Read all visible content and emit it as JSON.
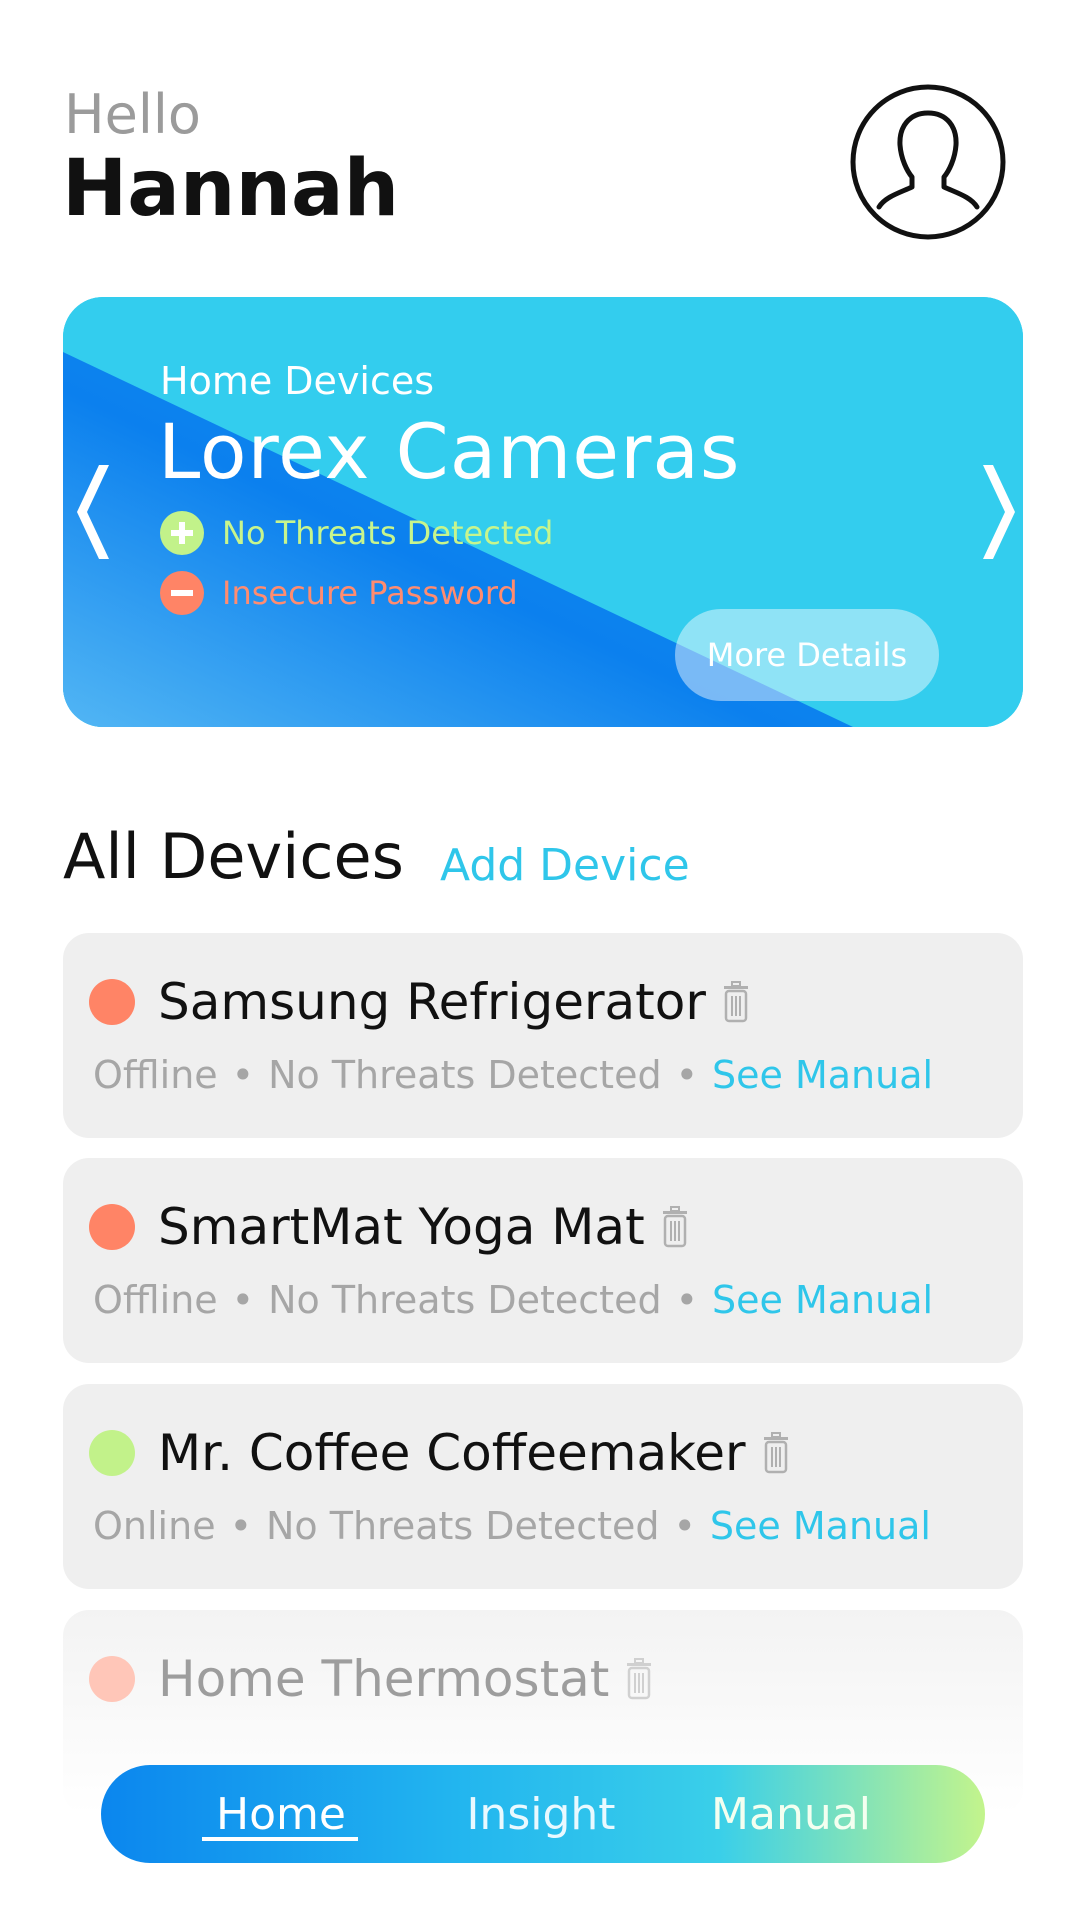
{
  "header": {
    "greeting": "Hello",
    "user_name": "Hannah",
    "avatar_icon": "user-avatar-icon"
  },
  "hero": {
    "subtitle": "Home Devices",
    "title": "Lorex Cameras",
    "statuses": [
      {
        "label": "No Threats Detected",
        "icon": "plus-circle-icon",
        "color": "#c7f58d"
      },
      {
        "label": "Insecure Password",
        "icon": "minus-circle-icon",
        "color": "#ff8c70"
      }
    ],
    "more_button": "More Details",
    "prev_icon": "chevron-left-icon",
    "next_icon": "chevron-right-icon",
    "gradient_colors": [
      "#0b7fee",
      "#33cdee"
    ]
  },
  "devices_section": {
    "title": "All Devices",
    "add_label": "Add Device"
  },
  "devices": [
    {
      "name": "Samsung Refrigerator",
      "state": "Offline",
      "threat": "No Threats Detected",
      "manual": "See Manual",
      "status_color": "#ff8466"
    },
    {
      "name": "SmartMat Yoga Mat",
      "state": "Offline",
      "threat": "No Threats Detected",
      "manual": "See Manual",
      "status_color": "#ff8466"
    },
    {
      "name": "Mr. Coffee Coffeemaker",
      "state": "Online",
      "threat": "No Threats Detected",
      "manual": "See Manual",
      "status_color": "#c2f28a"
    },
    {
      "name": "Home Thermostat",
      "state": "",
      "threat": "",
      "manual": "",
      "status_color": "#ffc6b8"
    }
  ],
  "nav": {
    "items": [
      {
        "label": "Home",
        "active": true
      },
      {
        "label": "Insight",
        "active": false
      },
      {
        "label": "Manual",
        "active": false
      }
    ]
  },
  "separator": "•",
  "accent_color": "#2fc6ea"
}
